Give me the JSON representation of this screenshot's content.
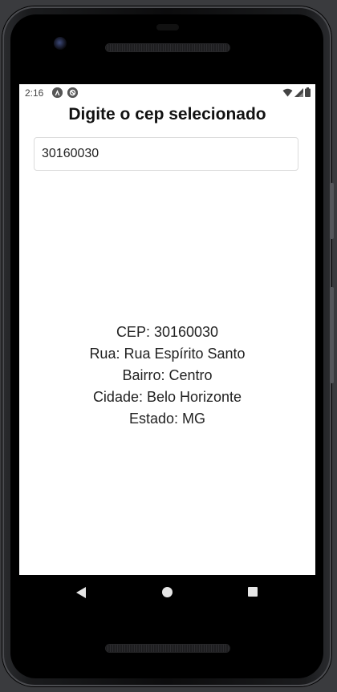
{
  "status_bar": {
    "time": "2:16"
  },
  "screen": {
    "title": "Digite o cep selecionado",
    "cep_input_value": "30160030",
    "info": {
      "cep": "CEP: 30160030",
      "rua": "Rua: Rua Espírito Santo",
      "bairro": "Bairro: Centro",
      "cidade": "Cidade: Belo Horizonte",
      "estado": "Estado: MG"
    }
  },
  "icons": {
    "status_app_1": "a-logo-icon",
    "status_app_2": "sync-icon",
    "wifi": "wifi-icon",
    "signal": "signal-icon",
    "battery": "battery-icon",
    "nav_back": "back-triangle-icon",
    "nav_home": "home-circle-icon",
    "nav_recents": "recents-square-icon"
  }
}
